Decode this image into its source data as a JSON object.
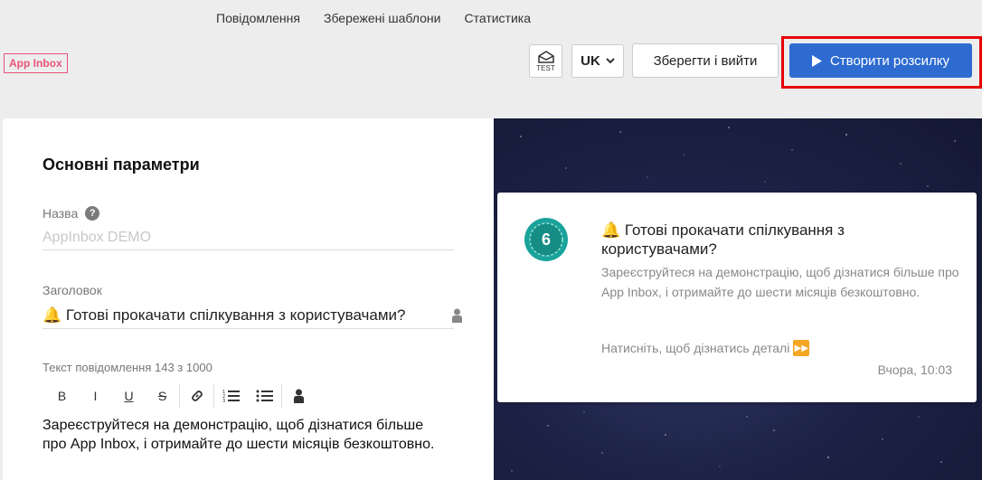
{
  "nav": {
    "messages": "Повідомлення",
    "templates": "Збережені шаблони",
    "stats": "Статистика"
  },
  "brand": "App Inbox",
  "toolbar": {
    "test_label": "TEST",
    "language": "UK",
    "save_exit": "Зберегти і вийти",
    "create_campaign": "Створити розсилку"
  },
  "form": {
    "section_title": "Основні параметри",
    "name_label": "Назва",
    "name_placeholder": "AppInbox DEMO",
    "header_label": "Заголовок",
    "header_value": "🔔 Готові прокачати спілкування з користувачами?",
    "body_label": "Текст повідомлення",
    "body_count": "143 з 1000",
    "body_text": "Зареєструйтеся на демонстрацію, щоб дізнатися більше про App Inbox, і отримайте до шести місяців безкоштовно.",
    "format_buttons": [
      "B",
      "I",
      "U",
      "S"
    ]
  },
  "preview": {
    "avatar_number": "6",
    "title": "🔔 Готові прокачати спілкування з користувачами?",
    "body": "Зареєструйтеся на демонстрацію, щоб дізнатися більше про App Inbox, і отримайте до шести місяців безкоштовно.",
    "cta": "Натисніть, щоб дізнатись деталі",
    "time": "Вчора, 10:03"
  },
  "colors": {
    "accent": "#2d6bd0",
    "brand": "#e8547a",
    "highlight": "#e60000",
    "avatar": "#1aa39a"
  }
}
